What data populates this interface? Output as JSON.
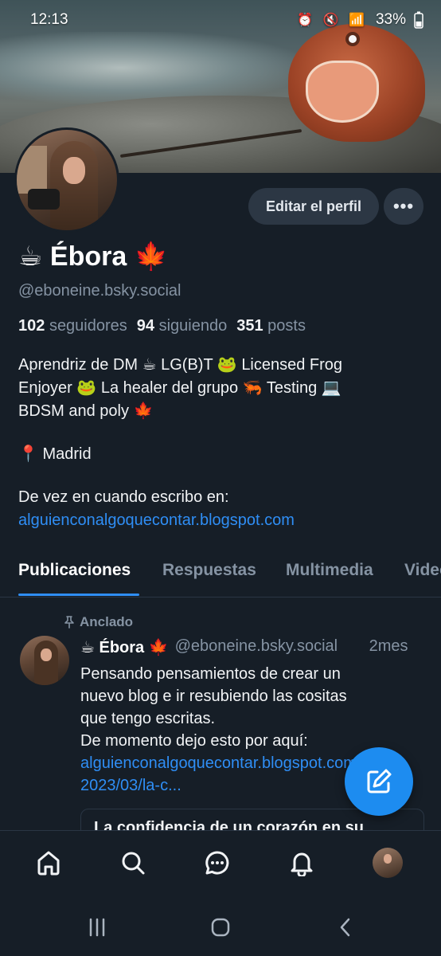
{
  "status_bar": {
    "time": "12:13",
    "icons": "⏰ 🔇 📶",
    "battery": "33%"
  },
  "profile": {
    "name": "☕ Ébora 🍁",
    "handle": "@eboneine.bsky.social",
    "edit_button": "Editar el perfil",
    "more_button": "•••",
    "stats": {
      "followers_count": "102",
      "followers_label": "seguidores",
      "following_count": "94",
      "following_label": "siguiendo",
      "posts_count": "351",
      "posts_label": "posts"
    },
    "bio": {
      "line1": "Aprendriz de DM ☕ LG(B)T 🐸 Licensed Frog",
      "line2": "Enjoyer 🐸  La healer del grupo 🦐 Testing 💻",
      "line3": "BDSM and poly 🍁",
      "location": "📍 Madrid",
      "line5": "De vez en cuando escribo en:",
      "link": "alguienconalgoquecontar.blogspot.com"
    }
  },
  "tabs": [
    {
      "label": "Publicaciones",
      "active": true
    },
    {
      "label": "Respuestas",
      "active": false
    },
    {
      "label": "Multimedia",
      "active": false
    },
    {
      "label": "Videos",
      "active": false
    }
  ],
  "post": {
    "pinned_label": "Anclado",
    "author_name": "☕ Ébora 🍁",
    "author_handle": "@eboneine.bsky.social",
    "time": "2mes",
    "text_line1": "Pensando pensamientos de crear un",
    "text_line2": "nuevo blog e ir resubiendo las cositas",
    "text_line3": "que tengo escritas.",
    "text_line4": "De momento dejo esto por aquí:",
    "link_line1": "alguienconalgoquecontar.blogspot.com/",
    "link_line2": "2023/03/la-c...",
    "embed_title": "La confidencia de un corazón en su"
  },
  "colors": {
    "background": "#161e27",
    "accent": "#2f8ef5",
    "muted": "#8593a3",
    "fab": "#1d8cf0"
  },
  "icons": {
    "fab": "compose-icon",
    "nav": [
      "home-icon",
      "search-icon",
      "chat-icon",
      "bell-icon",
      "profile-avatar"
    ],
    "system": [
      "recent-apps-icon",
      "home-circle-icon",
      "back-icon"
    ]
  }
}
